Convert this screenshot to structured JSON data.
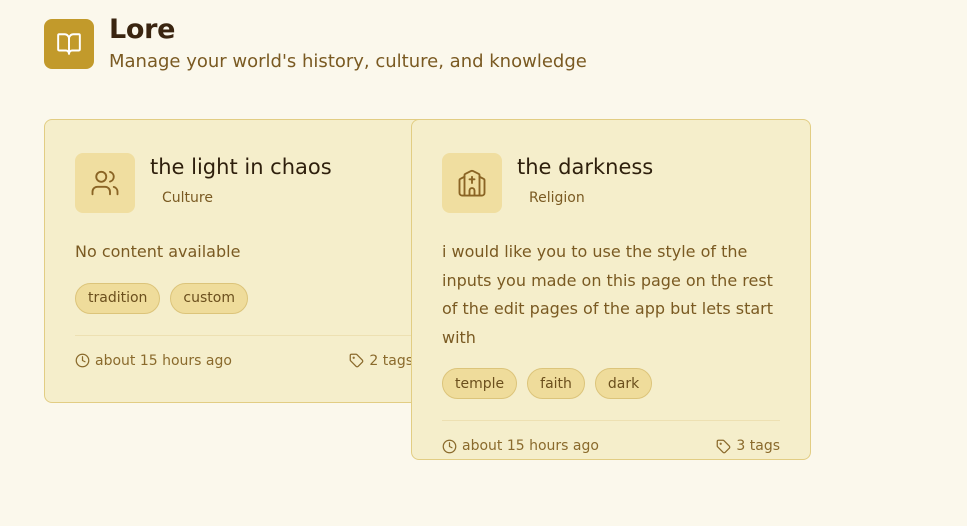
{
  "header": {
    "icon": "book-open-icon",
    "title": "Lore",
    "subtitle": "Manage your world's history, culture, and knowledge"
  },
  "colors": {
    "page_background": "#fbf8ec",
    "accent": "#c29a2b",
    "card_background": "#f5eecb",
    "tag_background": "#efdc9b"
  },
  "cards": [
    {
      "title": "the light in chaos",
      "category": "Culture",
      "icon": "users-icon",
      "content": "No content available",
      "tags": [
        "tradition",
        "custom"
      ],
      "updated": "about 15 hours ago",
      "tag_count": "2 tags"
    },
    {
      "title": "the darkness",
      "category": "Religion",
      "icon": "church-icon",
      "content": "i would like you to use the style of the inputs you made on this page on the rest of the edit pages of the app but lets start with",
      "tags": [
        "temple",
        "faith",
        "dark"
      ],
      "updated": "about 15 hours ago",
      "tag_count": "3 tags"
    }
  ]
}
